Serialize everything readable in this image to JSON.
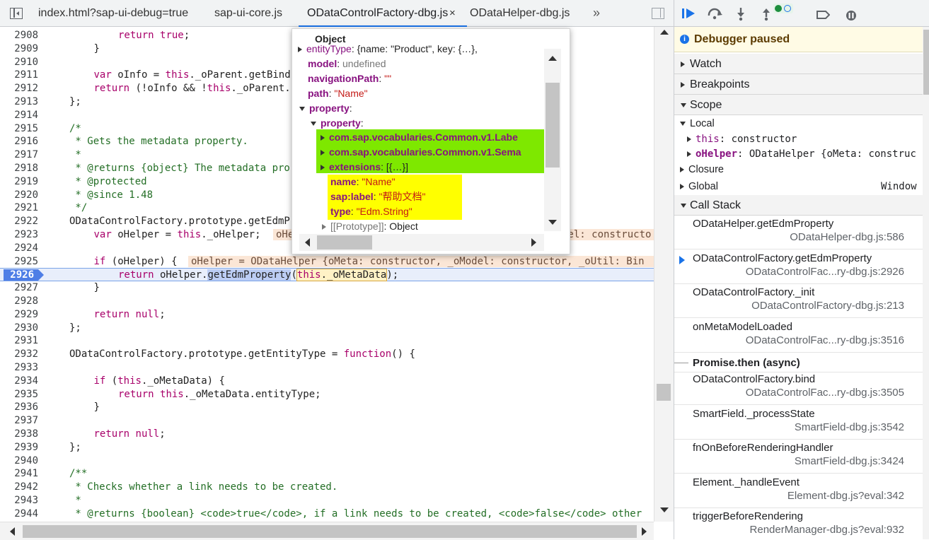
{
  "tabs": [
    {
      "label": "index.html?sap-ui-debug=true",
      "active": false
    },
    {
      "label": "sap-ui-core.js",
      "active": false
    },
    {
      "label": "ODataControlFactory-dbg.js",
      "active": true
    },
    {
      "label": "ODataHelper-dbg.js",
      "active": false
    }
  ],
  "tab_close": "×",
  "more_tabs": "»",
  "code": {
    "lines": [
      {
        "n": "2908",
        "t": "return true;",
        "indent": 2,
        "kind": "ret_true"
      },
      {
        "n": "2909",
        "t": "}",
        "indent": 1
      },
      {
        "n": "2910",
        "t": "",
        "indent": 0
      },
      {
        "n": "2911",
        "t": "var oInfo = this._oParent.getBind",
        "indent": 1,
        "kind": "var"
      },
      {
        "n": "2912",
        "t": "return (!oInfo && !this._oParent.",
        "indent": 1,
        "kind": "ret"
      },
      {
        "n": "2913",
        "t": "};",
        "indent": 0
      },
      {
        "n": "2914",
        "t": "",
        "indent": 0
      },
      {
        "n": "2915",
        "t": "/*",
        "indent": 0,
        "kind": "cm"
      },
      {
        "n": "2916",
        "t": " * Gets the metadata property.",
        "indent": 0,
        "kind": "cm"
      },
      {
        "n": "2917",
        "t": " *",
        "indent": 0,
        "kind": "cm"
      },
      {
        "n": "2918",
        "t": " * @returns {object} The metadata pro",
        "indent": 0,
        "kind": "cm"
      },
      {
        "n": "2919",
        "t": " * @protected",
        "indent": 0,
        "kind": "cm"
      },
      {
        "n": "2920",
        "t": " * @since 1.48",
        "indent": 0,
        "kind": "cm"
      },
      {
        "n": "2921",
        "t": " */",
        "indent": 0,
        "kind": "cm"
      },
      {
        "n": "2922",
        "t": "ODataControlFactory.prototype.getEdmP",
        "indent": 0
      },
      {
        "n": "2923",
        "t": "var oHelper = this._oHelper;",
        "indent": 1,
        "kind": "var"
      },
      {
        "n": "2924",
        "t": "",
        "indent": 0
      },
      {
        "n": "2925",
        "t": "if (oHelper) {",
        "indent": 1,
        "kind": "if"
      },
      {
        "n": "2926",
        "t": "",
        "indent": 2,
        "kind": "exec"
      },
      {
        "n": "2927",
        "t": "}",
        "indent": 1
      },
      {
        "n": "2928",
        "t": "",
        "indent": 0
      },
      {
        "n": "2929",
        "t": "return null;",
        "indent": 1,
        "kind": "retnull"
      },
      {
        "n": "2930",
        "t": "};",
        "indent": 0
      },
      {
        "n": "2931",
        "t": "",
        "indent": 0
      },
      {
        "n": "2932",
        "t": "ODataControlFactory.prototype.getEntityType = function() {",
        "indent": 0,
        "kind": "func"
      },
      {
        "n": "2933",
        "t": "",
        "indent": 0
      },
      {
        "n": "2934",
        "t": "if (this._oMetaData) {",
        "indent": 1,
        "kind": "ifthis"
      },
      {
        "n": "2935",
        "t": "return this._oMetaData.entityType;",
        "indent": 2,
        "kind": "retthis"
      },
      {
        "n": "2936",
        "t": "}",
        "indent": 1
      },
      {
        "n": "2937",
        "t": "",
        "indent": 0
      },
      {
        "n": "2938",
        "t": "return null;",
        "indent": 1,
        "kind": "retnull"
      },
      {
        "n": "2939",
        "t": "};",
        "indent": 0
      },
      {
        "n": "2940",
        "t": "",
        "indent": 0
      },
      {
        "n": "2941",
        "t": "/**",
        "indent": 0,
        "kind": "cm"
      },
      {
        "n": "2942",
        "t": " * Checks whether a link needs to be created.",
        "indent": 0,
        "kind": "cm"
      },
      {
        "n": "2943",
        "t": " *",
        "indent": 0,
        "kind": "cm"
      },
      {
        "n": "2944",
        "t": " * @returns {boolean} <code>true</code>, if a link needs to be created, <code>false</code> other",
        "indent": 0,
        "kind": "cm"
      }
    ],
    "exec_line": {
      "prefix": "return oHelper.",
      "fn": "getEdmProperty",
      "open": "(",
      "arg": "this._oMetaData",
      "close": ");"
    },
    "inline_2923": "oHe",
    "inline_2923_right": "lel: constructo",
    "inline_2925": "oHelper = ODataHelper {oMeta: constructor, _oModel: constructor, _oUtil: Bin"
  },
  "popover": {
    "title": "Object",
    "rows": [
      {
        "key": "entityType",
        "val": "{name: \"Product\", key: {…},"
      },
      {
        "key": "model",
        "val": "undefined"
      },
      {
        "key": "navigationPath",
        "val": "\"\""
      },
      {
        "key": "path",
        "val": "\"Name\""
      },
      {
        "key": "property",
        "val": ""
      },
      {
        "key": "property",
        "val": ""
      },
      {
        "key": "com.sap.vocabularies.Common.v1.Labe",
        "val": ""
      },
      {
        "key": "com.sap.vocabularies.Common.v1.Sema",
        "val": ""
      },
      {
        "key": "extensions",
        "val": "[{…}]"
      },
      {
        "key": "name",
        "val": "\"Name\""
      },
      {
        "key": "sap:label",
        "val": "\"帮助文档\""
      },
      {
        "key": "type",
        "val": "\"Edm.String\""
      },
      {
        "key": "[[Prototype]]",
        "val": "Object"
      }
    ]
  },
  "debugger": {
    "paused_label": "Debugger paused",
    "sections": {
      "watch": "Watch",
      "breakpoints": "Breakpoints",
      "scope": "Scope",
      "call_stack": "Call Stack"
    },
    "scope": {
      "local": "Local",
      "this_key": "this",
      "this_val": "constructor",
      "ohelper_key": "oHelper",
      "ohelper_val": "ODataHelper {oMeta: construc",
      "closure": "Closure",
      "global": "Global",
      "global_val": "Window"
    },
    "call_stack": [
      {
        "fn": "ODataHelper.getEdmProperty",
        "loc": "ODataHelper-dbg.js:586",
        "current": false
      },
      {
        "fn": "ODataControlFactory.getEdmProperty",
        "loc": "ODataControlFac...ry-dbg.js:2926",
        "current": true
      },
      {
        "fn": "ODataControlFactory._init",
        "loc": "ODataControlFactory-dbg.js:213",
        "current": false
      },
      {
        "fn": "onMetaModelLoaded",
        "loc": "ODataControlFac...ry-dbg.js:3516",
        "current": false
      }
    ],
    "async_label": "Promise.then (async)",
    "call_stack_async": [
      {
        "fn": "ODataControlFactory.bind",
        "loc": "ODataControlFac...ry-dbg.js:3505"
      },
      {
        "fn": "SmartField._processState",
        "loc": "SmartField-dbg.js:3542"
      },
      {
        "fn": "fnOnBeforeRenderingHandler",
        "loc": "SmartField-dbg.js:3424"
      },
      {
        "fn": "Element._handleEvent",
        "loc": "Element-dbg.js?eval:342"
      },
      {
        "fn": "triggerBeforeRendering",
        "loc": "RenderManager-dbg.js?eval:932"
      }
    ]
  },
  "colors": {
    "accent": "#1a73e8",
    "execution_line": "#4e7ee6",
    "highlight_green": "#7ee800",
    "highlight_yellow": "#ffff00"
  }
}
